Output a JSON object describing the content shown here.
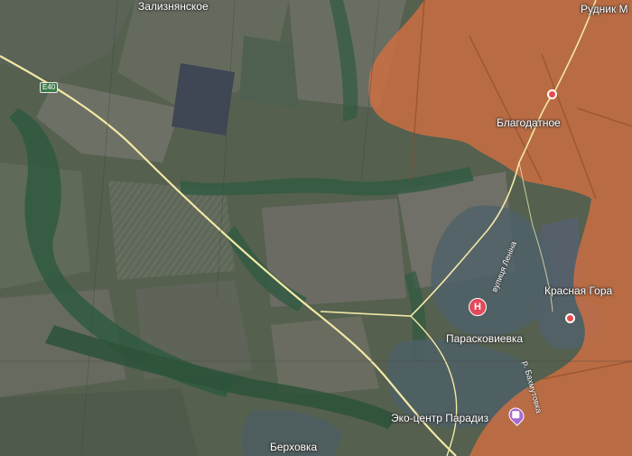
{
  "map": {
    "place_labels": {
      "zaliznyanskoe": "Зализнянское",
      "rudnik": "Рудник М",
      "blagodatnoe": "Благодатное",
      "krasnaya_gora": "Красная Гора",
      "paraskovievka": "Парасковиевка",
      "eko_centr": "Эко-центр Парадиз",
      "berhovka": "Берховка"
    },
    "street_labels": {
      "lenina": "вулиця Леніна",
      "bahmutovka": "р. Бахмутовка"
    },
    "road_shield": "E40",
    "poi": {
      "hospital_symbol": "H",
      "hospital_icon": "hospital-icon",
      "shop_icon": "shopping-icon"
    },
    "colors": {
      "occupied_overlay": "#e0703f",
      "road": "#f2e9a6",
      "hospital": "#e24a5a",
      "shop": "#a86bd1",
      "marker": "#e94c4c"
    }
  }
}
